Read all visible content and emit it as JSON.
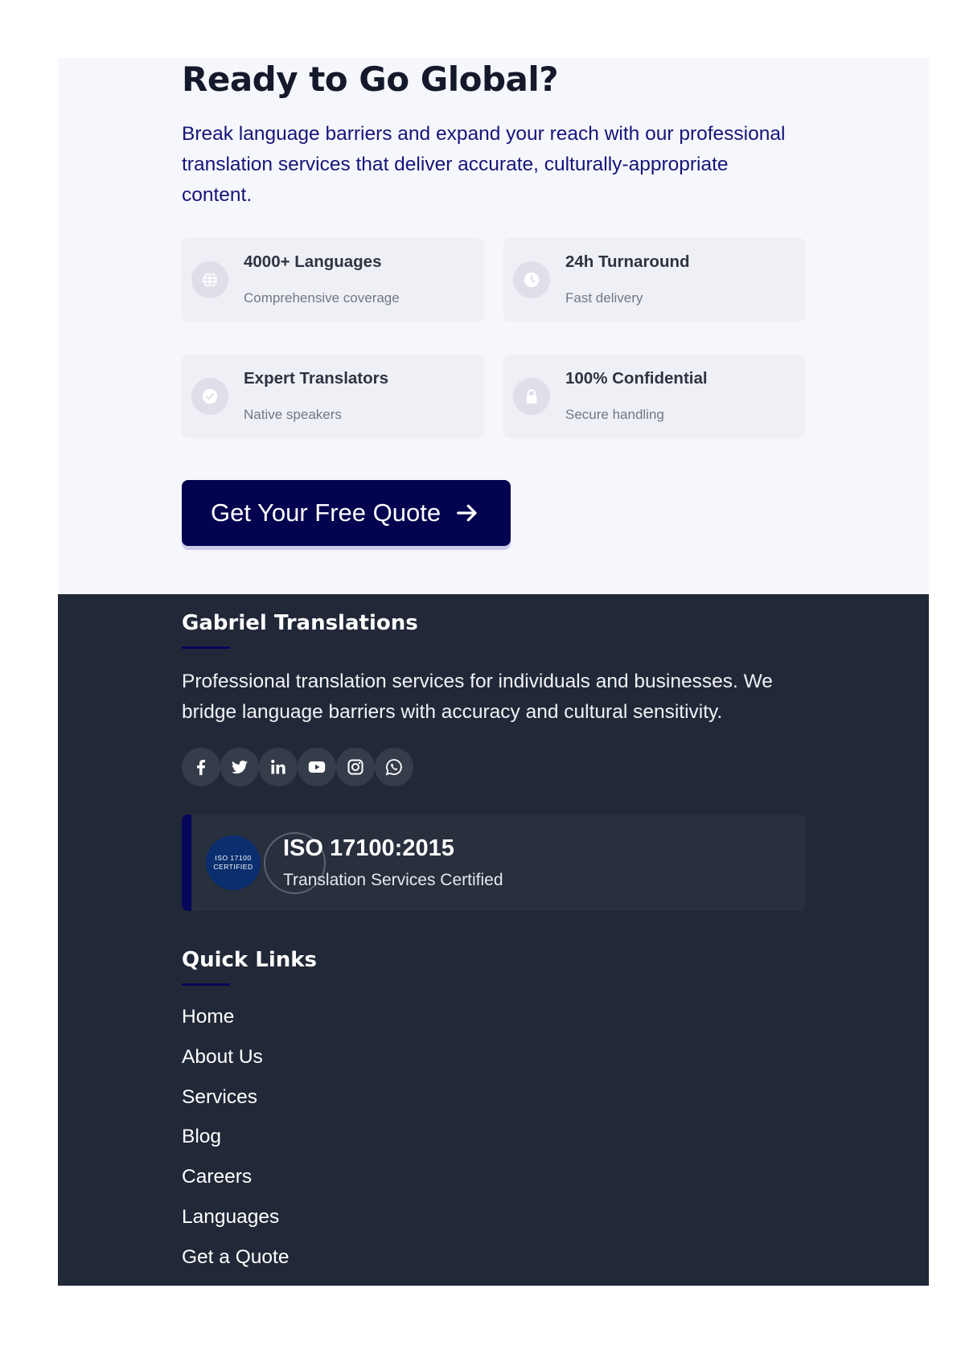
{
  "cta": {
    "title": "Ready to Go Global?",
    "description": "Break language barriers and expand your reach with our professional translation services that deliver accurate, culturally-appropriate content.",
    "features": [
      {
        "title": "4000+ Languages",
        "subtitle": "Comprehensive coverage",
        "icon": "globe-icon"
      },
      {
        "title": "24h Turnaround",
        "subtitle": "Fast delivery",
        "icon": "clock-icon"
      },
      {
        "title": "Expert Translators",
        "subtitle": "Native speakers",
        "icon": "check-circle-icon"
      },
      {
        "title": "100% Confidential",
        "subtitle": "Secure handling",
        "icon": "lock-icon"
      }
    ],
    "button_label": "Get Your Free Quote"
  },
  "footer": {
    "brand": "Gabriel Translations",
    "about": "Professional translation services for individuals and businesses. We bridge language barriers with accuracy and cultural sensitivity.",
    "socials": [
      "facebook-icon",
      "twitter-icon",
      "linkedin-icon",
      "youtube-icon",
      "instagram-icon",
      "whatsapp-icon"
    ],
    "iso": {
      "seal_line1": "ISO 17100",
      "seal_line2": "CERTIFIED",
      "title": "ISO 17100:2015",
      "subtitle": "Translation Services Certified"
    },
    "quick_links_title": "Quick Links",
    "quick_links": [
      "Home",
      "About Us",
      "Services",
      "Blog",
      "Careers",
      "Languages",
      "Get a Quote"
    ]
  },
  "colors": {
    "cta_bg": "#f6f7fc",
    "primary": "#04034f",
    "footer_bg": "#212938",
    "description_text": "#15157a"
  }
}
